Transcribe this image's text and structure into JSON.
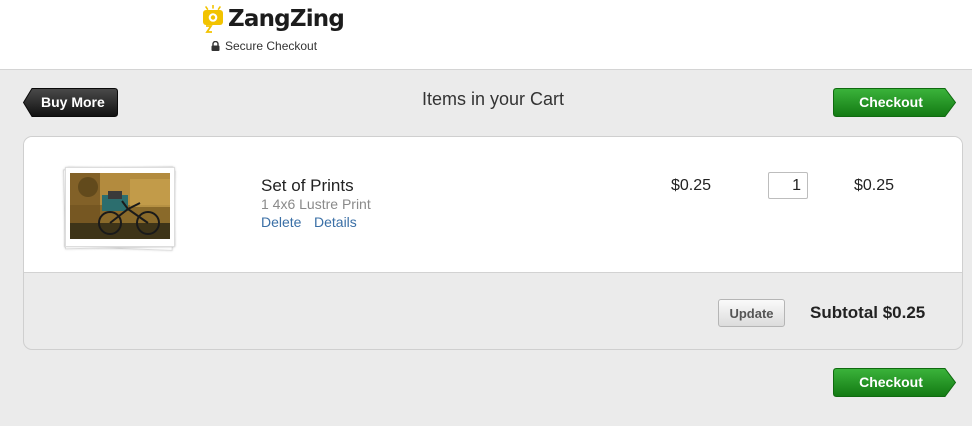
{
  "header": {
    "brand": "ZangZing",
    "secure_label": "Secure Checkout"
  },
  "toolbar": {
    "buy_more_label": "Buy More",
    "title": "Items in your Cart",
    "checkout_label": "Checkout"
  },
  "cart": {
    "items": [
      {
        "name": "Set of Prints",
        "description": "1 4x6 Lustre Print",
        "delete_label": "Delete",
        "details_label": "Details",
        "price": "$0.25",
        "quantity": "1",
        "total": "$0.25"
      }
    ],
    "update_label": "Update",
    "subtotal": "Subtotal $0.25"
  },
  "footer": {
    "checkout_label": "Checkout"
  },
  "colors": {
    "checkout_green": "#1f8f1f",
    "buy_more_dark": "#222222",
    "link_blue": "#3a6fa6",
    "logo_yellow": "#f2c300",
    "page_background": "#ebebeb"
  },
  "icons": [
    "zangzing-logo-icon",
    "lock-icon"
  ]
}
